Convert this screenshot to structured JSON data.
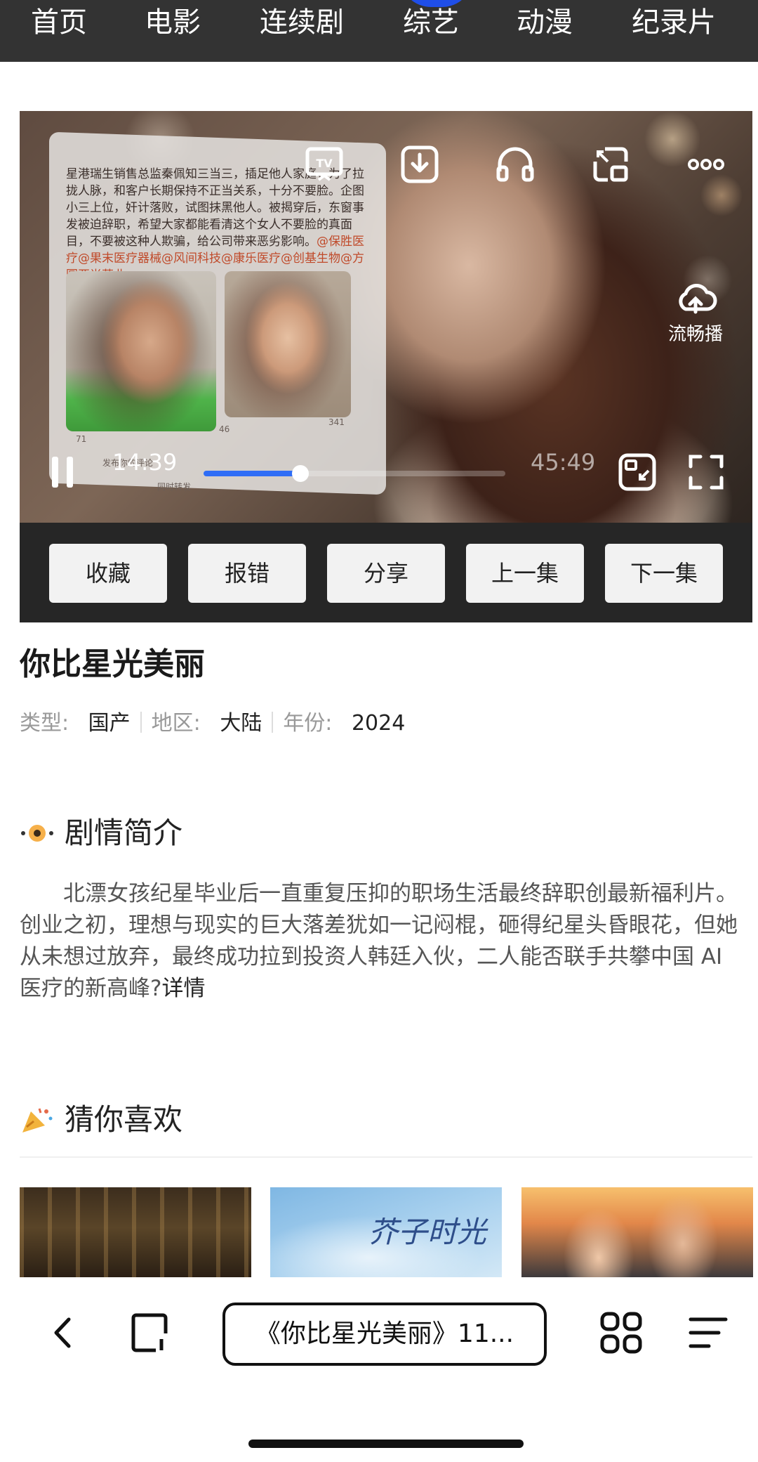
{
  "nav": {
    "items": [
      "首页",
      "电影",
      "连续剧",
      "综艺",
      "动漫",
      "纪录片"
    ],
    "accent": "#1f4ee8"
  },
  "player": {
    "overlay_text": "星港瑞生销售总监秦佩知三当三，插足他人家庭，为了拉拢人脉，和客户长期保持不正当关系，十分不要脸。企图小三上位，奸计落败，试图抹黑他人。被揭穿后，东窗事发被迫辞职，希望大家都能看清这个女人不要脸的真面目，不要被这种人欺骗，给公司带来恶劣影响。",
    "overlay_tags": "@保胜医疗@果末医疗器械@风间科技@康乐医疗@创基生物@方圆亚尚药业",
    "panel_counts": [
      "71",
      "46",
      "341"
    ],
    "panel_comment": "发布你的评论",
    "panel_repost": "同时转发",
    "icons": [
      "tv-cast-icon",
      "download-icon",
      "headphones-icon",
      "pip-icon",
      "more-icon",
      "cloud-upload-icon",
      "pause-icon",
      "fullscreen-exit-icon",
      "fullscreen-icon"
    ],
    "smooth_label": "流畅播",
    "current_time": "14:39",
    "total_time": "45:49",
    "progress": 0.32,
    "progress_color": "#2f6df6"
  },
  "actions": [
    "收藏",
    "报错",
    "分享",
    "上一集",
    "下一集"
  ],
  "show": {
    "title": "你比星光美丽",
    "type_label": "类型:",
    "type_value": "国产",
    "region_label": "地区:",
    "region_value": "大陆",
    "year_label": "年份:",
    "year_value": "2024"
  },
  "synopsis": {
    "heading": "剧情简介",
    "body": "北漂女孩纪星毕业后一直重复压抑的职场生活最终辞职创最新福利片。创业之初，理想与现实的巨大落差犹如一记闷棍，砸得纪星头昏眼花，但她从未想过放弃，最终成功拉到投资人韩廷入伙，二人能否联手共攀中国 AI 医疗的新高峰?",
    "more": "详情"
  },
  "recommend": {
    "heading": "猜你喜欢",
    "poster_text": "芥子时光"
  },
  "bottom": {
    "url_text": "《你比星光美丽》11..."
  }
}
